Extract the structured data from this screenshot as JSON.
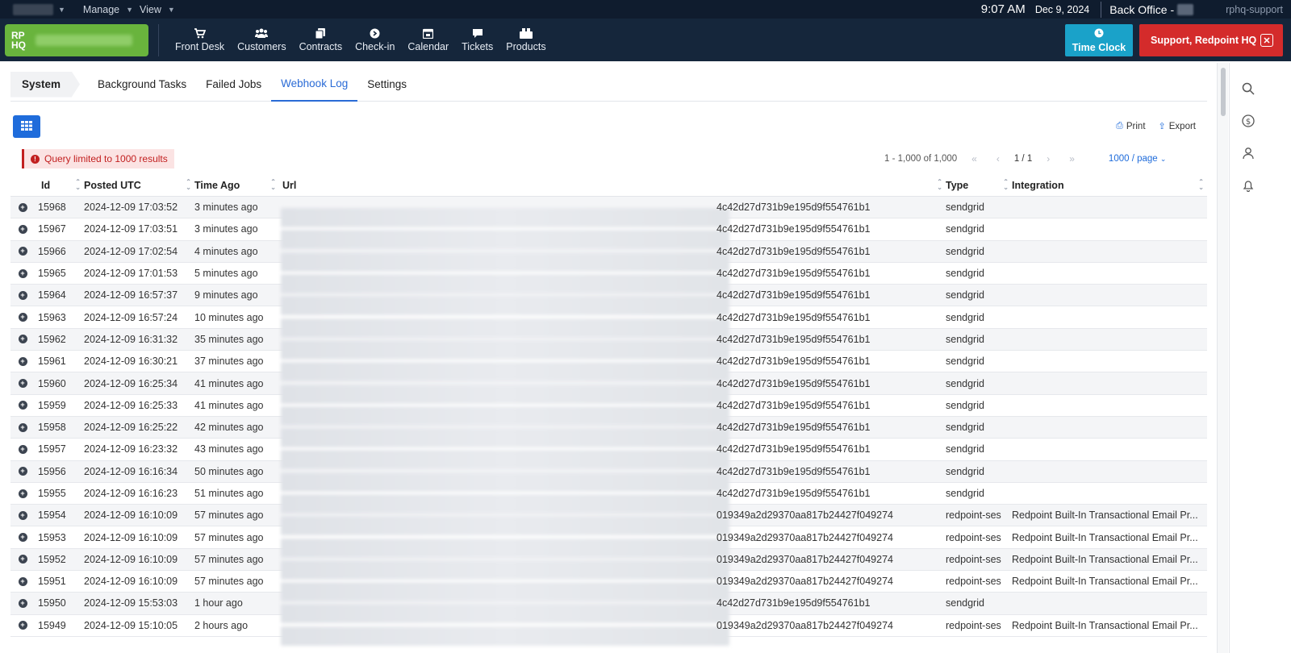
{
  "topbar": {
    "menus": [
      "Manage",
      "View"
    ],
    "time": "9:07 AM",
    "date": "Dec 9, 2024",
    "back_office": "Back Office -",
    "user": "rphq-support"
  },
  "nav": {
    "logo": "RP HQ",
    "items": [
      {
        "label": "Front Desk",
        "icon": "cart-icon"
      },
      {
        "label": "Customers",
        "icon": "users-icon"
      },
      {
        "label": "Contracts",
        "icon": "contracts-icon"
      },
      {
        "label": "Check-in",
        "icon": "checkin-icon"
      },
      {
        "label": "Calendar",
        "icon": "calendar-icon"
      },
      {
        "label": "Tickets",
        "icon": "chat-icon"
      },
      {
        "label": "Products",
        "icon": "products-icon"
      }
    ],
    "time_clock": "Time Clock",
    "support": "Support, Redpoint HQ"
  },
  "tabs": {
    "system": "System",
    "items": [
      "Background Tasks",
      "Failed Jobs",
      "Webhook Log",
      "Settings"
    ],
    "active": "Webhook Log"
  },
  "toolbar": {
    "print": "Print",
    "export": "Export",
    "alert": "Query limited to 1000 results",
    "range": "1 - 1,000 of 1,000",
    "page": "1 / 1",
    "per_page": "1000 / page"
  },
  "table": {
    "headers": [
      "Id",
      "Posted UTC",
      "Time Ago",
      "Url",
      "Type",
      "Integration"
    ],
    "rows": [
      {
        "id": "15968",
        "posted": "2024-12-09 17:03:52",
        "ago": "3 minutes ago",
        "url": "4c42d27d731b9e195d9f554761b1",
        "type": "sendgrid",
        "integration": ""
      },
      {
        "id": "15967",
        "posted": "2024-12-09 17:03:51",
        "ago": "3 minutes ago",
        "url": "4c42d27d731b9e195d9f554761b1",
        "type": "sendgrid",
        "integration": ""
      },
      {
        "id": "15966",
        "posted": "2024-12-09 17:02:54",
        "ago": "4 minutes ago",
        "url": "4c42d27d731b9e195d9f554761b1",
        "type": "sendgrid",
        "integration": ""
      },
      {
        "id": "15965",
        "posted": "2024-12-09 17:01:53",
        "ago": "5 minutes ago",
        "url": "4c42d27d731b9e195d9f554761b1",
        "type": "sendgrid",
        "integration": ""
      },
      {
        "id": "15964",
        "posted": "2024-12-09 16:57:37",
        "ago": "9 minutes ago",
        "url": "4c42d27d731b9e195d9f554761b1",
        "type": "sendgrid",
        "integration": ""
      },
      {
        "id": "15963",
        "posted": "2024-12-09 16:57:24",
        "ago": "10 minutes ago",
        "url": "4c42d27d731b9e195d9f554761b1",
        "type": "sendgrid",
        "integration": ""
      },
      {
        "id": "15962",
        "posted": "2024-12-09 16:31:32",
        "ago": "35 minutes ago",
        "url": "4c42d27d731b9e195d9f554761b1",
        "type": "sendgrid",
        "integration": ""
      },
      {
        "id": "15961",
        "posted": "2024-12-09 16:30:21",
        "ago": "37 minutes ago",
        "url": "4c42d27d731b9e195d9f554761b1",
        "type": "sendgrid",
        "integration": ""
      },
      {
        "id": "15960",
        "posted": "2024-12-09 16:25:34",
        "ago": "41 minutes ago",
        "url": "4c42d27d731b9e195d9f554761b1",
        "type": "sendgrid",
        "integration": ""
      },
      {
        "id": "15959",
        "posted": "2024-12-09 16:25:33",
        "ago": "41 minutes ago",
        "url": "4c42d27d731b9e195d9f554761b1",
        "type": "sendgrid",
        "integration": ""
      },
      {
        "id": "15958",
        "posted": "2024-12-09 16:25:22",
        "ago": "42 minutes ago",
        "url": "4c42d27d731b9e195d9f554761b1",
        "type": "sendgrid",
        "integration": ""
      },
      {
        "id": "15957",
        "posted": "2024-12-09 16:23:32",
        "ago": "43 minutes ago",
        "url": "4c42d27d731b9e195d9f554761b1",
        "type": "sendgrid",
        "integration": ""
      },
      {
        "id": "15956",
        "posted": "2024-12-09 16:16:34",
        "ago": "50 minutes ago",
        "url": "4c42d27d731b9e195d9f554761b1",
        "type": "sendgrid",
        "integration": ""
      },
      {
        "id": "15955",
        "posted": "2024-12-09 16:16:23",
        "ago": "51 minutes ago",
        "url": "4c42d27d731b9e195d9f554761b1",
        "type": "sendgrid",
        "integration": ""
      },
      {
        "id": "15954",
        "posted": "2024-12-09 16:10:09",
        "ago": "57 minutes ago",
        "url": "019349a2d29370aa817b24427f049274",
        "type": "redpoint-ses",
        "integration": "Redpoint Built-In Transactional Email Pr..."
      },
      {
        "id": "15953",
        "posted": "2024-12-09 16:10:09",
        "ago": "57 minutes ago",
        "url": "019349a2d29370aa817b24427f049274",
        "type": "redpoint-ses",
        "integration": "Redpoint Built-In Transactional Email Pr..."
      },
      {
        "id": "15952",
        "posted": "2024-12-09 16:10:09",
        "ago": "57 minutes ago",
        "url": "019349a2d29370aa817b24427f049274",
        "type": "redpoint-ses",
        "integration": "Redpoint Built-In Transactional Email Pr..."
      },
      {
        "id": "15951",
        "posted": "2024-12-09 16:10:09",
        "ago": "57 minutes ago",
        "url": "019349a2d29370aa817b24427f049274",
        "type": "redpoint-ses",
        "integration": "Redpoint Built-In Transactional Email Pr..."
      },
      {
        "id": "15950",
        "posted": "2024-12-09 15:53:03",
        "ago": "1 hour ago",
        "url": "4c42d27d731b9e195d9f554761b1",
        "type": "sendgrid",
        "integration": ""
      },
      {
        "id": "15949",
        "posted": "2024-12-09 15:10:05",
        "ago": "2 hours ago",
        "url": "019349a2d29370aa817b24427f049274",
        "type": "redpoint-ses",
        "integration": "Redpoint Built-In Transactional Email Pr..."
      }
    ]
  },
  "colors": {
    "nav_bg": "#15263b",
    "topbar_bg": "#0f1c2e",
    "logo": "#69b43d",
    "time_clock": "#1aa2c9",
    "support": "#d42b2b",
    "accent": "#2a6bd6"
  },
  "sidebar_icons": [
    "search-icon",
    "dollar-icon",
    "user-icon",
    "bell-icon"
  ]
}
